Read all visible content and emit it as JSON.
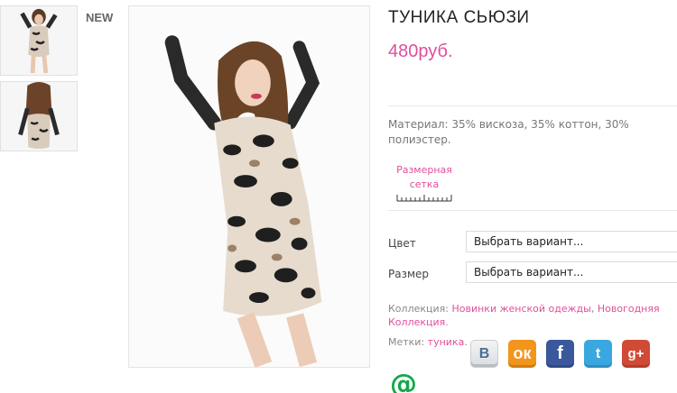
{
  "badge": {
    "new": "NEW"
  },
  "product": {
    "title": "ТУНИКА СЬЮЗИ",
    "price": "480руб.",
    "material": "Материал: 35% вискоза, 35% коттон, 30% полиэстер.",
    "size_chart_label": "Размерная сетка"
  },
  "options": {
    "color_label": "Цвет",
    "color_value": "Выбрать вариант...",
    "size_label": "Размер",
    "size_value": "Выбрать вариант..."
  },
  "collection": {
    "label": "Коллекция:",
    "link1": "Новинки женской одежды",
    "separator": ",",
    "link2": "Новогодняя Коллекция",
    "end": "."
  },
  "tags": {
    "label": "Метки:",
    "link": "туника",
    "end": "."
  },
  "social": {
    "vk": "B",
    "ok": "ок",
    "fb": "f",
    "tw": "t",
    "gp": "g+",
    "mail": "@"
  },
  "colors": {
    "accent_pink": "#e24e9b",
    "vk": "#4a6d94",
    "ok": "#f2951c",
    "facebook": "#3a589b",
    "twitter": "#3aa7e0",
    "googleplus": "#d14a36",
    "mail": "#11a84a"
  }
}
